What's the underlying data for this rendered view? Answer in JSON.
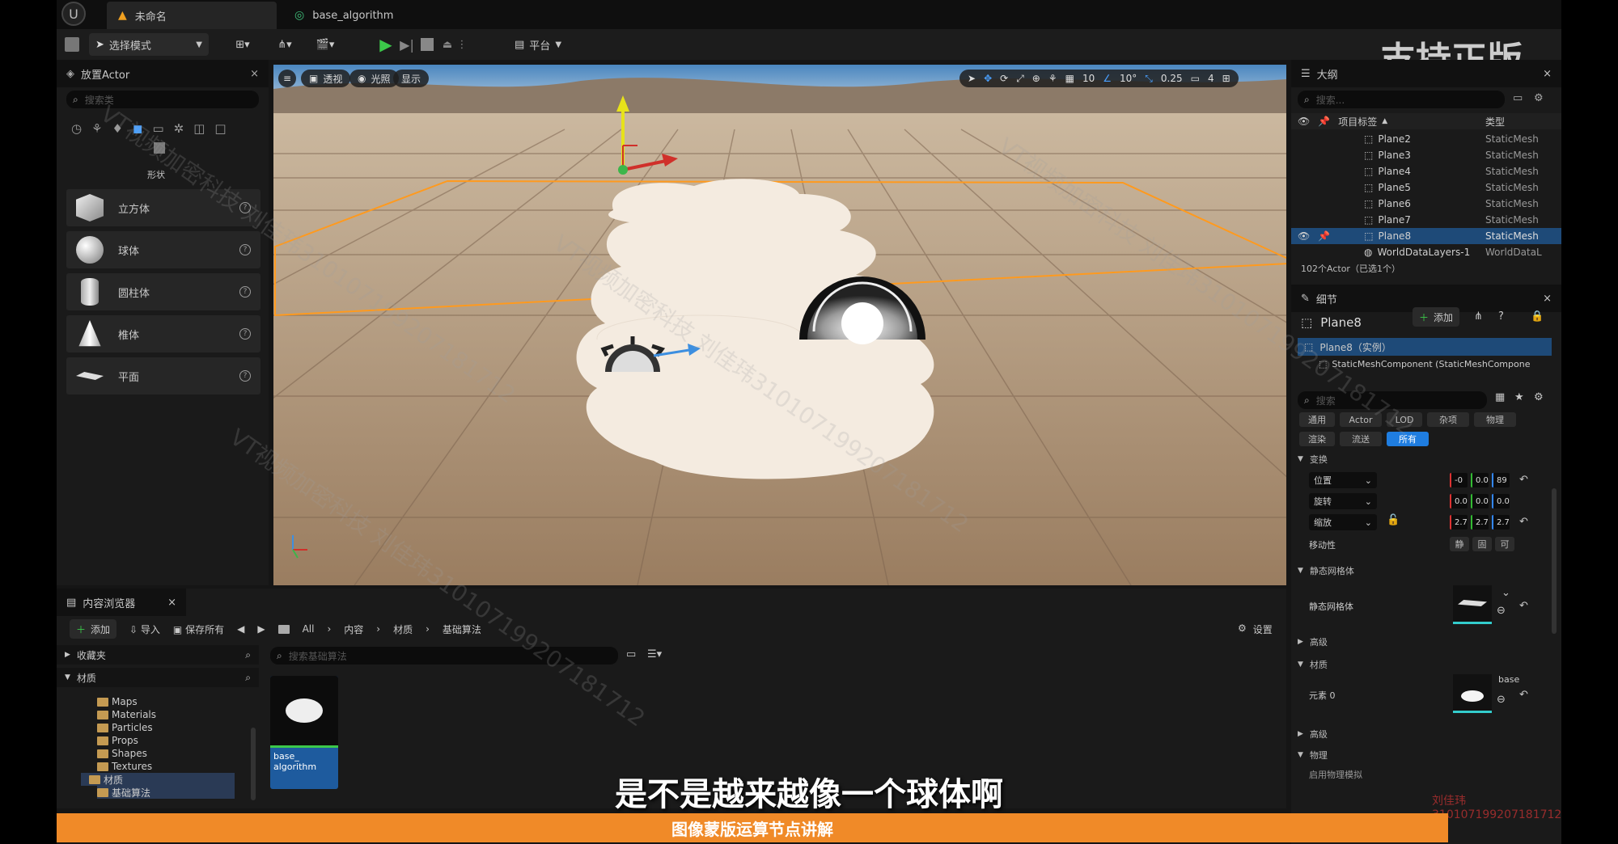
{
  "tabs": {
    "active": "未命名",
    "second": "base_algorithm"
  },
  "toolbar": {
    "mode": "选择模式",
    "platform": "平台"
  },
  "watermark_corner": "支持正版",
  "place_actor": {
    "title": "放置Actor",
    "search_placeholder": "搜索类",
    "category": "形状",
    "shapes": [
      {
        "label": "立方体"
      },
      {
        "label": "球体"
      },
      {
        "label": "圆柱体"
      },
      {
        "label": "椎体"
      },
      {
        "label": "平面"
      }
    ]
  },
  "viewport": {
    "buttons": {
      "perspective": "透视",
      "lighting": "光照",
      "show": "显示"
    },
    "grid": "10",
    "angle": "10°",
    "scale": "0.25",
    "camera": "4"
  },
  "outliner": {
    "title": "大纲",
    "search_placeholder": "搜索...",
    "col_label": "项目标签",
    "col_type": "类型",
    "rows": [
      {
        "name": "Plane2",
        "type": "StaticMesh"
      },
      {
        "name": "Plane3",
        "type": "StaticMesh"
      },
      {
        "name": "Plane4",
        "type": "StaticMesh"
      },
      {
        "name": "Plane5",
        "type": "StaticMesh"
      },
      {
        "name": "Plane6",
        "type": "StaticMesh"
      },
      {
        "name": "Plane7",
        "type": "StaticMesh"
      },
      {
        "name": "Plane8",
        "type": "StaticMesh"
      },
      {
        "name": "WorldDataLayers-1",
        "type": "WorldDataL"
      }
    ],
    "status": "102个Actor（已选1个）"
  },
  "details": {
    "title": "细节",
    "object": "Plane8",
    "add": "添加",
    "instance": "Plane8（实例）",
    "component": "StaticMeshComponent (StaticMeshCompone",
    "search_placeholder": "搜索",
    "filters": [
      "通用",
      "Actor",
      "LOD",
      "杂项",
      "物理",
      "渲染",
      "流送",
      "所有"
    ],
    "transform": "变换",
    "location": "位置",
    "rotation": "旋转",
    "scale": "缩放",
    "loc_vals": [
      "-0",
      "0.0",
      "89"
    ],
    "rot_vals": [
      "0.0",
      "0.0",
      "0.0"
    ],
    "scale_vals": [
      "2.7",
      "2.7",
      "2.7"
    ],
    "mobility": "移动性",
    "mobility_opts": [
      "静",
      "固",
      "可"
    ],
    "static_mesh_section": "静态网格体",
    "static_mesh": "静态网格体",
    "advanced": "高级",
    "materials": "材质",
    "element0": "元素 0",
    "material_name": "base",
    "advanced2": "高级",
    "physics": "物理",
    "truncated": "启用物理模拟"
  },
  "content_browser": {
    "title": "内容浏览器",
    "add": "添加",
    "import": "导入",
    "save_all": "保存所有",
    "path": [
      "All",
      "内容",
      "材质",
      "基础算法"
    ],
    "settings": "设置",
    "favorites": "收藏夹",
    "materials": "材质",
    "search_placeholder": "搜索基础算法",
    "tree": [
      "Maps",
      "Materials",
      "Particles",
      "Props",
      "Shapes",
      "Textures"
    ],
    "tree_materials": "材质",
    "tree_selected": "基础算法",
    "asset": "base_ algorithm"
  },
  "subtitle": "是不是越来越像一个球体啊",
  "banner": "图像蒙版运算节点讲解",
  "red_watermark": "刘佳玮310107199207181712",
  "watermark_text": "VT视频加密科技 刘佳玮310107199207181712"
}
